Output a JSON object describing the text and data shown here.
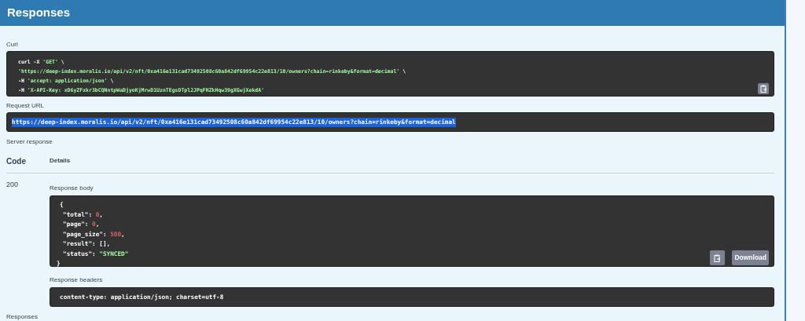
{
  "section_header": {
    "title": "Responses"
  },
  "curl": {
    "label": "Curl",
    "lines": [
      [
        {
          "text": "curl -X ",
          "kind": "plain"
        },
        {
          "text": "'GET'",
          "kind": "string"
        },
        {
          "text": " \\",
          "kind": "plain"
        }
      ],
      [
        {
          "text": "'https://deep-index.moralis.io/api/v2/nft/0xa416e131cad73492508c60a842df69954c22e813/10/owners?chain=rinkeby&format=decimal'",
          "kind": "string"
        },
        {
          "text": " \\",
          "kind": "plain"
        }
      ],
      [
        {
          "text": "-H ",
          "kind": "plain"
        },
        {
          "text": "'accept: application/json'",
          "kind": "string"
        },
        {
          "text": " \\",
          "kind": "plain"
        }
      ],
      [
        {
          "text": "-H ",
          "kind": "plain"
        },
        {
          "text": "'X-API-Key: xD6yZFxkr3bCQNntpWaDjyoKjMrwD1UznTEgsDTpl2JPqFNZkHqw39gXGwjXekdA'",
          "kind": "string"
        }
      ]
    ]
  },
  "request_url": {
    "label": "Request URL",
    "value": "https://deep-index.moralis.io/api/v2/nft/0xa416e131cad73492508c60a842df69954c22e813/10/owners?chain=rinkeby&format=decimal",
    "selected": true
  },
  "server_response": {
    "label": "Server response",
    "columns": [
      "Code",
      "Details"
    ],
    "code": "200",
    "body_label": "Response body",
    "body_lines": [
      [
        {
          "text": "{",
          "kind": "plain"
        }
      ],
      [
        {
          "text": "\"total\"",
          "kind": "plain"
        },
        {
          "text": ": ",
          "kind": "plain"
        },
        {
          "text": "0",
          "kind": "number"
        },
        {
          "text": ",",
          "kind": "plain"
        }
      ],
      [
        {
          "text": "\"page\"",
          "kind": "plain"
        },
        {
          "text": ": ",
          "kind": "plain"
        },
        {
          "text": "0",
          "kind": "number"
        },
        {
          "text": ",",
          "kind": "plain"
        }
      ],
      [
        {
          "text": "\"page_size\"",
          "kind": "plain"
        },
        {
          "text": ": ",
          "kind": "plain"
        },
        {
          "text": "500",
          "kind": "number"
        },
        {
          "text": ",",
          "kind": "plain"
        }
      ],
      [
        {
          "text": "\"result\"",
          "kind": "plain"
        },
        {
          "text": ": [],",
          "kind": "plain"
        }
      ],
      [
        {
          "text": "\"status\"",
          "kind": "plain"
        },
        {
          "text": ": ",
          "kind": "plain"
        },
        {
          "text": "\"SYNCED\"",
          "kind": "string"
        }
      ],
      [
        {
          "text": "}",
          "kind": "plain"
        }
      ]
    ],
    "download_button": "Download",
    "headers_label": "Response headers",
    "headers_value": "content-type: application/json; charset=utf-8"
  },
  "footer_label": "Responses"
}
